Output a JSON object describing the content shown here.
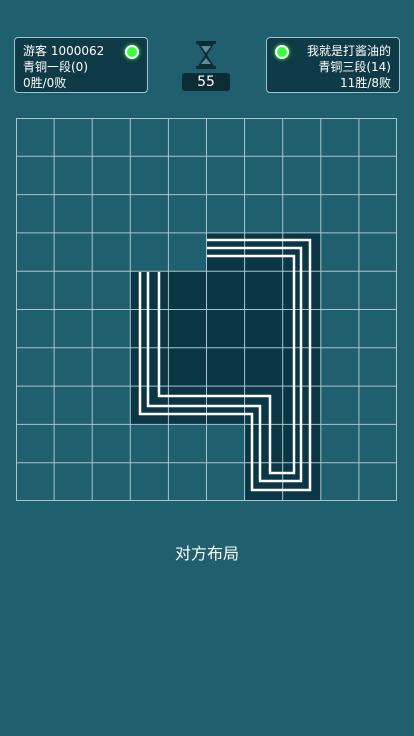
{
  "players": {
    "self": {
      "name": "游客 1000062",
      "rank": "青铜一段(0)",
      "record": "0胜/0败"
    },
    "opponent": {
      "name": "我就是打酱油的",
      "rank": "青铜三段(14)",
      "record": "11胜/8败"
    }
  },
  "timer": {
    "seconds": "55"
  },
  "board": {
    "cols": 10,
    "rows": 10,
    "highlighted_cells": [
      [
        3,
        5
      ],
      [
        3,
        6
      ],
      [
        3,
        7
      ],
      [
        4,
        3
      ],
      [
        4,
        4
      ],
      [
        4,
        5
      ],
      [
        4,
        6
      ],
      [
        4,
        7
      ],
      [
        5,
        3
      ],
      [
        5,
        4
      ],
      [
        5,
        5
      ],
      [
        5,
        6
      ],
      [
        5,
        7
      ],
      [
        6,
        3
      ],
      [
        6,
        4
      ],
      [
        6,
        5
      ],
      [
        6,
        6
      ],
      [
        6,
        7
      ],
      [
        7,
        3
      ],
      [
        7,
        4
      ],
      [
        7,
        5
      ],
      [
        7,
        6
      ],
      [
        7,
        7
      ],
      [
        8,
        6
      ],
      [
        8,
        7
      ],
      [
        9,
        6
      ],
      [
        9,
        7
      ]
    ]
  },
  "caption": "对方布局",
  "colors": {
    "background": "#1f5f6e",
    "grid_line": "#a9c7cf",
    "cell_highlight": "#0b3645",
    "path_line": "#ffffff",
    "status_dot": "#39ff3f"
  }
}
